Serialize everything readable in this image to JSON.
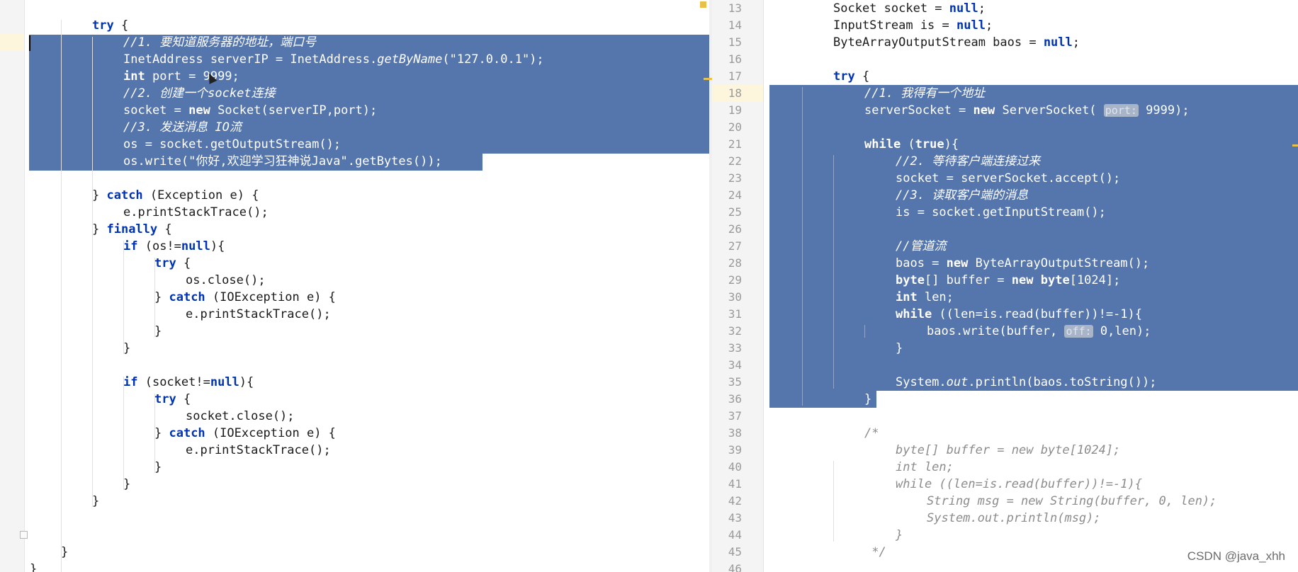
{
  "left_pane": {
    "lines": [
      {
        "html": "<span class=\"kw\">try</span> {",
        "indent": 1
      },
      {
        "html": "<span class=\"cm\">//1. 要知道服务器的地址，端口号</span>",
        "indent": 2
      },
      {
        "html": "InetAddress serverIP = InetAddress.<span class=\"mi\">getByName</span>(\"127.0.0.1\");",
        "indent": 2
      },
      {
        "html": "<span class=\"kw\">int</span> port = 9999;",
        "indent": 2
      },
      {
        "html": "<span class=\"cm\">//2. 创建一个socket连接</span>",
        "indent": 2
      },
      {
        "html": "socket = <span class=\"kw\">new</span> Socket(serverIP,port);",
        "indent": 2
      },
      {
        "html": "<span class=\"cm\">//3. 发送消息 IO流</span>",
        "indent": 2
      },
      {
        "html": "os = socket.getOutputStream();",
        "indent": 2
      },
      {
        "html": "os.write(\"你好,欢迎学习狂神说Java\".getBytes());",
        "indent": 2
      },
      {
        "html": "",
        "indent": 0
      },
      {
        "html": "} <span class=\"kw\">catch</span> (Exception e) {",
        "indent": 1
      },
      {
        "html": "e.printStackTrace();",
        "indent": 2
      },
      {
        "html": "} <span class=\"kw\">finally</span> {",
        "indent": 1
      },
      {
        "html": "<span class=\"kw\">if</span> (os!=<span class=\"kw\">null</span>){",
        "indent": 2
      },
      {
        "html": "<span class=\"kw\">try</span> {",
        "indent": 3
      },
      {
        "html": "os.close();",
        "indent": 4
      },
      {
        "html": "} <span class=\"kw\">catch</span> (IOException e) {",
        "indent": 3
      },
      {
        "html": "e.printStackTrace();",
        "indent": 4
      },
      {
        "html": "}",
        "indent": 3
      },
      {
        "html": "}",
        "indent": 2
      },
      {
        "html": "",
        "indent": 0
      },
      {
        "html": "<span class=\"kw\">if</span> (socket!=<span class=\"kw\">null</span>){",
        "indent": 2
      },
      {
        "html": "<span class=\"kw\">try</span> {",
        "indent": 3
      },
      {
        "html": "socket.close();",
        "indent": 4
      },
      {
        "html": "} <span class=\"kw\">catch</span> (IOException e) {",
        "indent": 3
      },
      {
        "html": "e.printStackTrace();",
        "indent": 4
      },
      {
        "html": "}",
        "indent": 3
      },
      {
        "html": "}",
        "indent": 2
      },
      {
        "html": "}",
        "indent": 1
      },
      {
        "html": "",
        "indent": 0
      },
      {
        "html": "",
        "indent": 0
      },
      {
        "html": "}",
        "indent": 0
      },
      {
        "html": "}",
        "indent": -1
      }
    ]
  },
  "right_pane": {
    "line_numbers": [
      "13",
      "14",
      "15",
      "16",
      "17",
      "18",
      "19",
      "20",
      "21",
      "22",
      "23",
      "24",
      "25",
      "26",
      "27",
      "28",
      "29",
      "30",
      "31",
      "32",
      "33",
      "34",
      "35",
      "36",
      "37",
      "38",
      "39",
      "40",
      "41",
      "42",
      "43",
      "44",
      "45",
      "46"
    ],
    "current_line": "18",
    "lines": [
      {
        "html": "Socket socket = <span class=\"kw\">null</span>;",
        "indent": 2
      },
      {
        "html": "InputStream is = <span class=\"kw\">null</span>;",
        "indent": 2
      },
      {
        "html": "ByteArrayOutputStream baos = <span class=\"kw\">null</span>;",
        "indent": 2
      },
      {
        "html": "",
        "indent": 0
      },
      {
        "html": "<span class=\"kw\">try</span> {",
        "indent": 2
      },
      {
        "html": "<span class=\"cm\">//1. 我得有一个地址</span>",
        "indent": 3
      },
      {
        "html": "serverSocket = <span class=\"kw\">new</span> ServerSocket( <span class=\"hint\">port:</span> 9999);",
        "indent": 3
      },
      {
        "html": "",
        "indent": 0
      },
      {
        "html": "<span class=\"kw\">while</span> (<span class=\"kw\">true</span>){",
        "indent": 3
      },
      {
        "html": "<span class=\"cm\">//2. 等待客户端连接过来</span>",
        "indent": 4
      },
      {
        "html": "socket = serverSocket.accept();",
        "indent": 4
      },
      {
        "html": "<span class=\"cm\">//3. 读取客户端的消息</span>",
        "indent": 4
      },
      {
        "html": "is = socket.getInputStream();",
        "indent": 4
      },
      {
        "html": "",
        "indent": 0
      },
      {
        "html": "<span class=\"cm\">//管道流</span>",
        "indent": 4
      },
      {
        "html": "baos = <span class=\"kw\">new</span> ByteArrayOutputStream();",
        "indent": 4
      },
      {
        "html": "<span class=\"kw\">byte</span>[] buffer = <span class=\"kw\">new</span> <span class=\"kw\">byte</span>[1024];",
        "indent": 4
      },
      {
        "html": "<span class=\"kw\">int</span> len;",
        "indent": 4
      },
      {
        "html": "<span class=\"kw\">while</span> ((len=is.read(buffer))!=-1){",
        "indent": 4
      },
      {
        "html": "baos.write(buffer, <span class=\"hint\">off:</span> 0,len);",
        "indent": 5
      },
      {
        "html": "}",
        "indent": 4
      },
      {
        "html": "",
        "indent": 0
      },
      {
        "html": "System.<span class=\"mi\">out</span>.println(baos.toString());",
        "indent": 4
      },
      {
        "html": "}",
        "indent": 3
      },
      {
        "html": "",
        "indent": 0
      },
      {
        "html": "<span class=\"cm\">/*</span>",
        "indent": 3
      },
      {
        "html": "<span class=\"cm\">byte[] buffer = new byte[1024];</span>",
        "indent": 4
      },
      {
        "html": "<span class=\"cm\">int len;</span>",
        "indent": 4
      },
      {
        "html": "<span class=\"cm\">while ((len=is.read(buffer))!=-1){</span>",
        "indent": 4
      },
      {
        "html": "<span class=\"cm\">String msg = new String(buffer, 0, len);</span>",
        "indent": 5
      },
      {
        "html": "<span class=\"cm\">System.out.println(msg);</span>",
        "indent": 5
      },
      {
        "html": "<span class=\"cm\">}</span>",
        "indent": 4
      },
      {
        "html": "<span class=\"cm\"> */</span>",
        "indent": 3
      },
      {
        "html": "",
        "indent": 0
      }
    ]
  },
  "watermark": "CSDN @java_xhh",
  "colors": {
    "selection": "#5575ad",
    "keyword": "#0033b3",
    "comment": "#8c8c8c",
    "current_line": "#fdf5dc"
  }
}
